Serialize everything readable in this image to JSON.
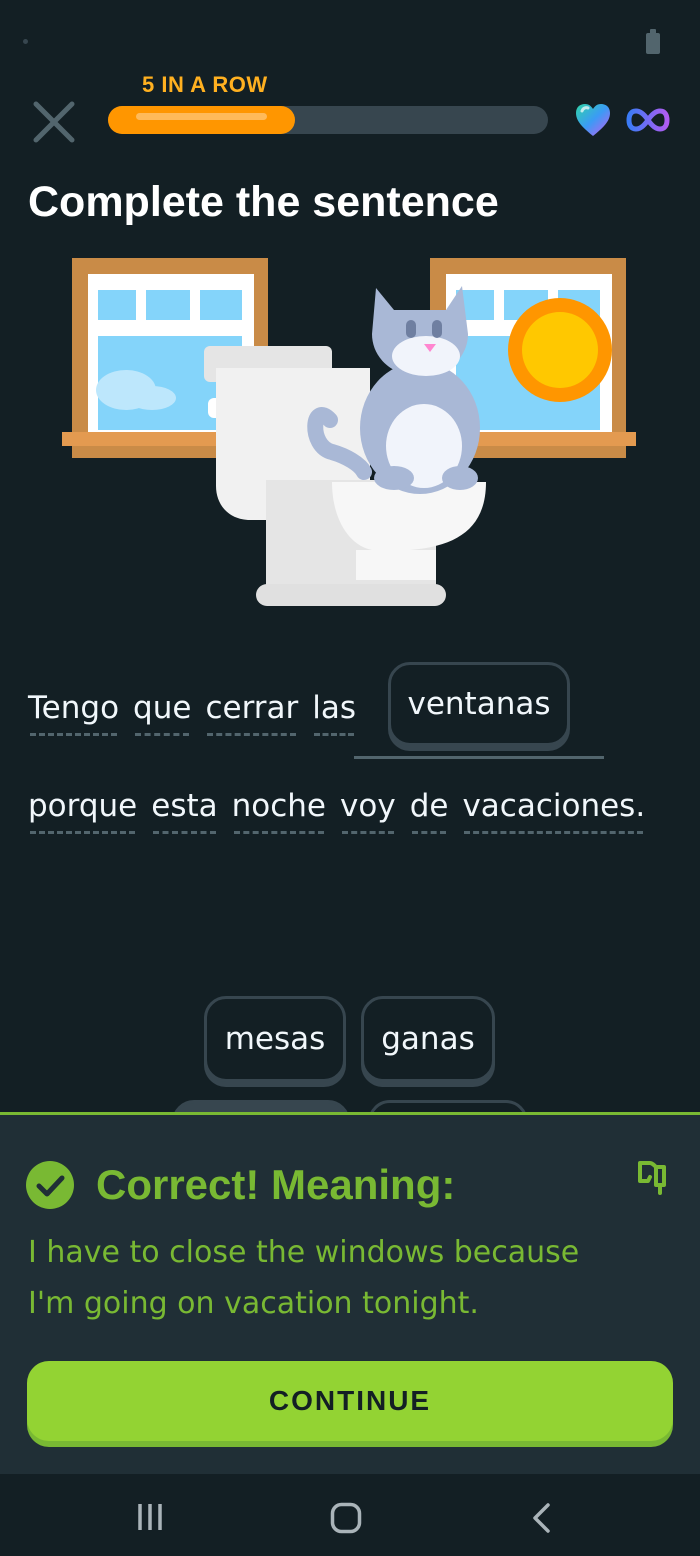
{
  "header": {
    "streak_label": "5 IN A ROW",
    "progress_fraction": 0.425,
    "hearts": "infinite"
  },
  "title": "Complete the sentence",
  "sentence": {
    "line1_words": [
      "Tengo",
      "que",
      "cerrar",
      "las"
    ],
    "answer": "ventanas",
    "line2_words": [
      "porque",
      "esta",
      "noche",
      "voy",
      "de",
      "vacaciones."
    ]
  },
  "word_bank": {
    "options": [
      "mesas",
      "ganas"
    ]
  },
  "feedback": {
    "title": "Correct! Meaning:",
    "line1": "I have to close the windows because",
    "line2": "I'm going on vacation tonight.",
    "continue_label": "CONTINUE"
  },
  "colors": {
    "background": "#131f24",
    "streak": "#ffb020",
    "progress": "#ff9600",
    "correct_green": "#79b933",
    "button_green": "#93d333"
  }
}
